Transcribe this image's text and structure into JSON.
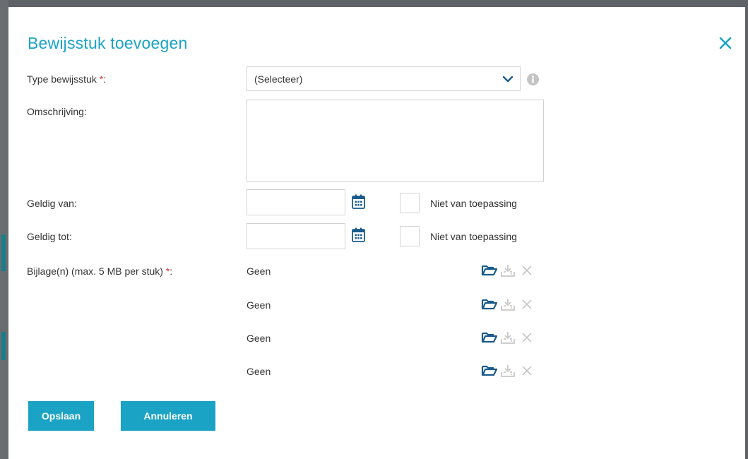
{
  "dialog": {
    "title": "Bewijsstuk toevoegen",
    "close_icon": "close-icon",
    "accent_color": "#1aa3c4",
    "required_color": "#e53935"
  },
  "form": {
    "type_label": "Type bewijsstuk",
    "required_mark": "*",
    "label_suffix": ":",
    "type_value": "(Selecteer)",
    "description_label": "Omschrijving:",
    "valid_from_label": "Geldig van:",
    "valid_to_label": "Geldig tot:",
    "not_applicable_label": "Niet van toepassing",
    "attachments_label": "Bijlage(n) (max. 5 MB per stuk)",
    "attachments": [
      {
        "value": "Geen"
      },
      {
        "value": "Geen"
      },
      {
        "value": "Geen"
      },
      {
        "value": "Geen"
      }
    ]
  },
  "buttons": {
    "save": "Opslaan",
    "cancel": "Annuleren"
  }
}
